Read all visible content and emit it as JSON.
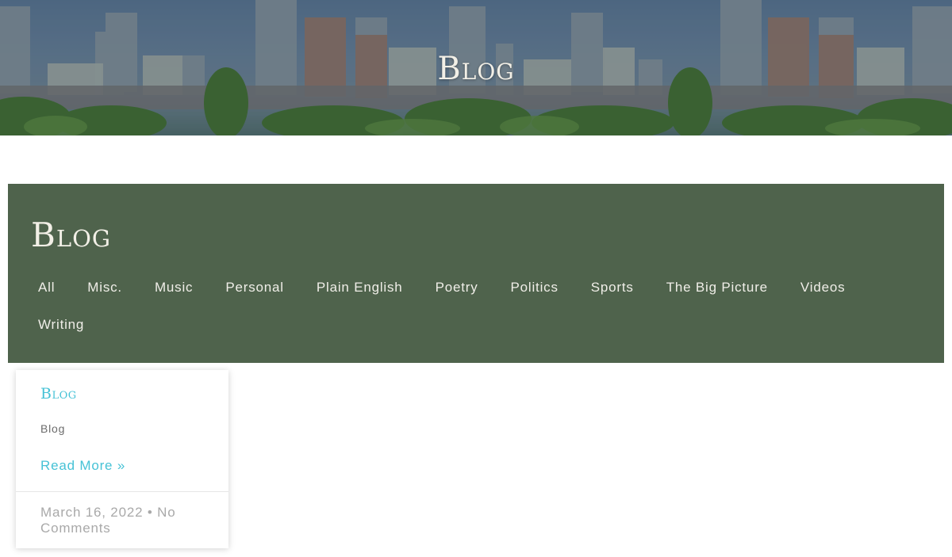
{
  "hero": {
    "title": "Blog"
  },
  "panel": {
    "title": "Blog",
    "categories": [
      "All",
      "Misc.",
      "Music",
      "Personal",
      "Plain English",
      "Poetry",
      "Politics",
      "Sports",
      "The Big Picture",
      "Videos",
      "Writing"
    ],
    "background_color": "#4f634c"
  },
  "post": {
    "title": "Blog",
    "excerpt": "Blog",
    "read_more": "Read More »",
    "date": "March 16, 2022",
    "separator": "•",
    "comments": "No Comments"
  },
  "colors": {
    "accent": "#46c2d6",
    "panel": "#4f634c",
    "meta_text": "#a9a9a9"
  }
}
